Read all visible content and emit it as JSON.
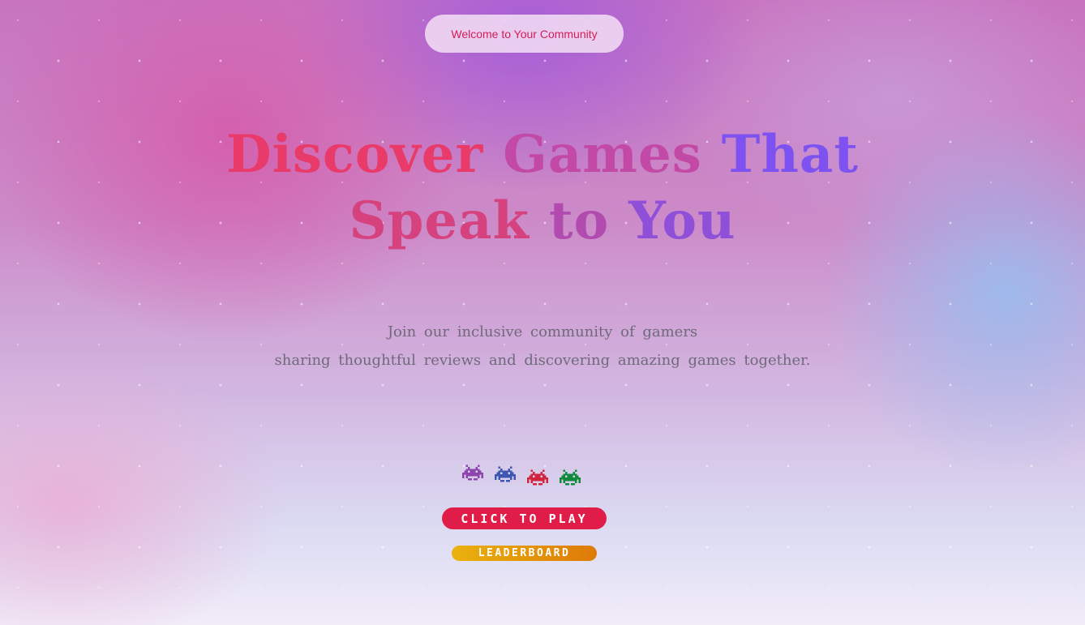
{
  "badge": {
    "label": "Welcome to Your Community"
  },
  "hero": {
    "line1": [
      "Discover",
      "Games",
      "That"
    ],
    "line2": [
      "Speak",
      "to",
      "You"
    ],
    "subtitle_line1": "Join our inclusive community of gamers",
    "subtitle_line2": "sharing thoughtful reviews and discovering amazing games together."
  },
  "invaders": [
    {
      "icon": "space-invader-icon",
      "color": "#8e44ad"
    },
    {
      "icon": "space-invader-icon",
      "color": "#3d56b2"
    },
    {
      "icon": "space-invader-icon",
      "color": "#d0243f"
    },
    {
      "icon": "space-invader-icon",
      "color": "#0f8a3a"
    }
  ],
  "actions": {
    "play_label": "CLICK TO PLAY",
    "leaderboard_label": "LEADERBOARD"
  },
  "colors": {
    "accent_red": "#e01c48",
    "accent_gold": "#eab20e",
    "headline_pink": "#e83b6a",
    "headline_purple": "#7d52f0"
  }
}
